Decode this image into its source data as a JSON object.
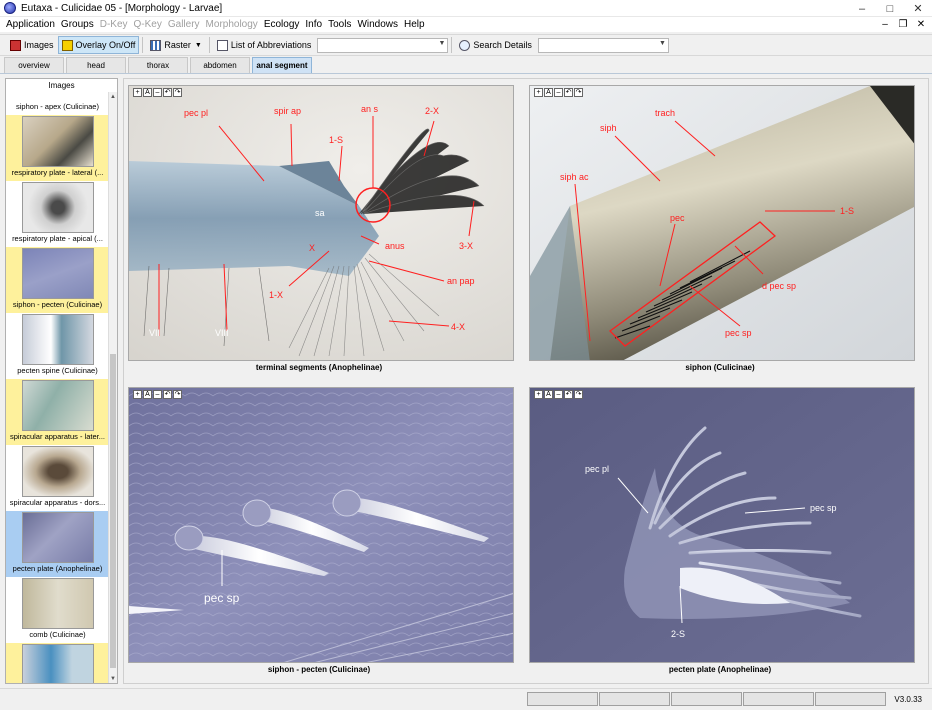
{
  "window": {
    "title": "Eutaxa - Culicidae 05 - [Morphology - Larvae]",
    "controls": {
      "minimize": "–",
      "maximize": "□",
      "close": "✕"
    }
  },
  "menubar": {
    "items": [
      {
        "label": "Application",
        "disabled": false
      },
      {
        "label": "Groups",
        "disabled": false
      },
      {
        "label": "D-Key",
        "disabled": true
      },
      {
        "label": "Q-Key",
        "disabled": true
      },
      {
        "label": "Gallery",
        "disabled": true
      },
      {
        "label": "Morphology",
        "disabled": true
      },
      {
        "label": "Ecology",
        "disabled": false
      },
      {
        "label": "Info",
        "disabled": false
      },
      {
        "label": "Tools",
        "disabled": false
      },
      {
        "label": "Windows",
        "disabled": false
      },
      {
        "label": "Help",
        "disabled": false
      }
    ],
    "mdi_controls": {
      "minimize": "–",
      "restore": "❐",
      "close": "✕"
    }
  },
  "toolbar": {
    "images_label": "Images",
    "overlay_label": "Overlay On/Off",
    "raster_label": "Raster",
    "abbreviations_label": "List of Abbreviations",
    "search_label": "Search Details"
  },
  "tabs": [
    {
      "label": "overview",
      "active": false
    },
    {
      "label": "head",
      "active": false
    },
    {
      "label": "thorax",
      "active": false
    },
    {
      "label": "abdomen",
      "active": false
    },
    {
      "label": "anal segment",
      "active": true
    }
  ],
  "sidebar": {
    "header": "Images",
    "items": [
      {
        "caption": "siphon - apex  (Culicinae)",
        "style": "white"
      },
      {
        "caption": "respiratory plate - lateral  (...",
        "style": "yellow"
      },
      {
        "caption": "respiratory plate - apical  (...",
        "style": "white"
      },
      {
        "caption": "siphon - pecten  (Culicinae)",
        "style": "yellow"
      },
      {
        "caption": "pecten spine  (Culicinae)",
        "style": "white"
      },
      {
        "caption": "spiracular apparatus - later...",
        "style": "yellow"
      },
      {
        "caption": "spiracular apparatus - dors...",
        "style": "white"
      },
      {
        "caption": "pecten plate  (Anophelinae)",
        "style": "selected"
      },
      {
        "caption": "comb  (Culicinae)",
        "style": "white"
      },
      {
        "caption": "",
        "style": "yellow"
      }
    ]
  },
  "zoom_controls": [
    "+",
    "A",
    "–",
    "↶",
    "↷"
  ],
  "panels": [
    {
      "caption": "terminal segments  (Anophelinae)",
      "labels": [
        "pec pl",
        "spir ap",
        "an s",
        "2-X",
        "1-S",
        "sa",
        "X",
        "anus",
        "3-X",
        "an pap",
        "1-X",
        "4-X",
        "VII",
        "VIII"
      ]
    },
    {
      "caption": "siphon  (Culicinae)",
      "labels": [
        "siph",
        "trach",
        "siph ac",
        "pec",
        "1-S",
        "d pec sp",
        "pec sp"
      ]
    },
    {
      "caption": "siphon - pecten  (Culicinae)",
      "labels": [
        "pec sp"
      ]
    },
    {
      "caption": "pecten plate  (Anophelinae)",
      "labels": [
        "pec pl",
        "pec sp",
        "2-S"
      ]
    }
  ],
  "statusbar": {
    "version": "V3.0.33"
  },
  "colors": {
    "annotation_red": "#ff2020",
    "selected_blue": "#a9cdf2",
    "highlight_yellow": "#fef19c",
    "active_tab": "#cfe2f5"
  }
}
